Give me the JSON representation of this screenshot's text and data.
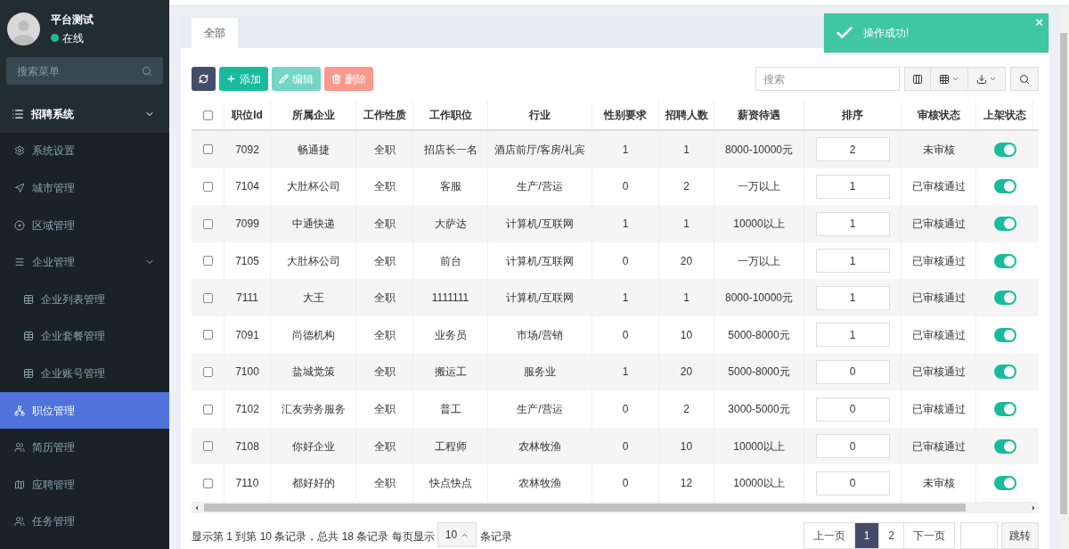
{
  "user": {
    "name": "平台测试",
    "status": "在线",
    "online": true
  },
  "sidebar": {
    "search": {
      "placeholder": "搜索菜单"
    },
    "menu": [
      {
        "label": "招聘系统",
        "expanded": true,
        "selected": false,
        "children": [
          {
            "label": "系统设置",
            "selected": false
          },
          {
            "label": "城市管理",
            "selected": false
          },
          {
            "label": "区域管理",
            "selected": false
          },
          {
            "label": "企业管理",
            "selected": false,
            "expanded": true,
            "children": [
              {
                "label": "企业列表管理",
                "selected": false
              },
              {
                "label": "企业套餐管理",
                "selected": false
              },
              {
                "label": "企业账号管理",
                "selected": false
              }
            ]
          },
          {
            "label": "职位管理",
            "selected": true
          },
          {
            "label": "简历管理",
            "selected": false
          },
          {
            "label": "应聘管理",
            "selected": false
          },
          {
            "label": "任务管理",
            "selected": false
          }
        ]
      }
    ]
  },
  "tabs": [
    {
      "label": "全部",
      "selected": true
    }
  ],
  "toast": {
    "message": "操作成功!",
    "close": "×"
  },
  "toolbar": {
    "buttons": [
      {
        "kind": "refresh",
        "disabled": false
      },
      {
        "kind": "add",
        "label": "添加",
        "disabled": false
      },
      {
        "kind": "edit",
        "label": "编辑",
        "disabled": true
      },
      {
        "kind": "delete",
        "label": "删除",
        "disabled": true
      }
    ],
    "search": {
      "placeholder": "搜索"
    }
  },
  "table": {
    "select_all": false,
    "columns": [
      "职位Id",
      "所属企业",
      "工作性质",
      "工作职位",
      "行业",
      "性别要求",
      "招聘人数",
      "薪资待遇",
      "排序",
      "审核状态",
      "上架状态"
    ],
    "rows": [
      {
        "checked": false,
        "cells": [
          "7092",
          "畅通捷",
          "全职",
          "招店长一名",
          "酒店前厅/客房/礼宾",
          "1",
          "1",
          "8000-10000元"
        ],
        "sort": "2",
        "review": "未审核",
        "on": true
      },
      {
        "checked": false,
        "cells": [
          "7104",
          "大肚杯公司",
          "全职",
          "客服",
          "生产/营运",
          "0",
          "2",
          "一万以上"
        ],
        "sort": "1",
        "review": "已审核通过",
        "on": true
      },
      {
        "checked": false,
        "cells": [
          "7099",
          "中通快递",
          "全职",
          "大萨达",
          "计算机/互联网",
          "1",
          "1",
          "10000以上"
        ],
        "sort": "1",
        "review": "已审核通过",
        "on": true
      },
      {
        "checked": false,
        "cells": [
          "7105",
          "大肚杯公司",
          "全职",
          "前台",
          "计算机/互联网",
          "0",
          "20",
          "一万以上"
        ],
        "sort": "1",
        "review": "已审核通过",
        "on": true
      },
      {
        "checked": false,
        "cells": [
          "7111",
          "大王",
          "全职",
          "1111111",
          "计算机/互联网",
          "1",
          "1",
          "8000-10000元"
        ],
        "sort": "1",
        "review": "已审核通过",
        "on": true
      },
      {
        "checked": false,
        "cells": [
          "7091",
          "尚德机构",
          "全职",
          "业务员",
          "市场/营销",
          "0",
          "10",
          "5000-8000元"
        ],
        "sort": "1",
        "review": "已审核通过",
        "on": true
      },
      {
        "checked": false,
        "cells": [
          "7100",
          "盐城觉策",
          "全职",
          "搬运工",
          "服务业",
          "1",
          "20",
          "5000-8000元"
        ],
        "sort": "0",
        "review": "已审核通过",
        "on": true
      },
      {
        "checked": false,
        "cells": [
          "7102",
          "汇友劳务服务",
          "全职",
          "普工",
          "生产/营运",
          "0",
          "2",
          "3000-5000元"
        ],
        "sort": "0",
        "review": "已审核通过",
        "on": true
      },
      {
        "checked": false,
        "cells": [
          "7108",
          "你好企业",
          "全职",
          "工程师",
          "农林牧渔",
          "0",
          "10",
          "10000以上"
        ],
        "sort": "0",
        "review": "已审核通过",
        "on": true
      },
      {
        "checked": false,
        "cells": [
          "7110",
          "都好好的",
          "全职",
          "快点快点",
          "农林牧渔",
          "0",
          "12",
          "10000以上"
        ],
        "sort": "0",
        "review": "未审核",
        "on": true
      }
    ]
  },
  "footer": {
    "summary_before": "显示第 1 到第 10 条记录，总共 18 条记录 每页显示",
    "page_size": "10",
    "summary_after": "条记录",
    "pages": [
      {
        "label": "上一页",
        "selected": false
      },
      {
        "label": "1",
        "selected": true
      },
      {
        "label": "2",
        "selected": false
      },
      {
        "label": "下一页",
        "selected": false
      }
    ],
    "jump": "跳转"
  }
}
